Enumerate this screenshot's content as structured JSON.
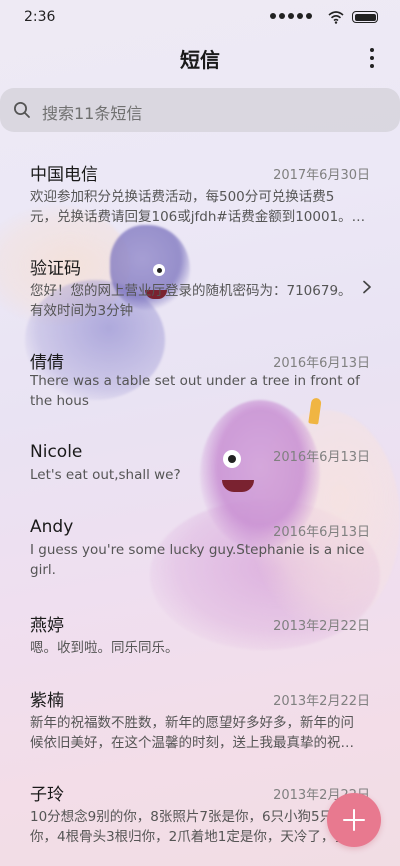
{
  "status_bar": {
    "time": "2:36",
    "icons": [
      "signal-dots-icon",
      "wifi-icon",
      "battery-icon"
    ]
  },
  "header": {
    "title": "短信",
    "more_icon": "more-vertical-icon"
  },
  "search": {
    "placeholder": "搜索11条短信",
    "icon": "search-icon"
  },
  "messages": [
    {
      "name": "中国电信",
      "date": "2017年6月30日",
      "line1": "欢迎参加积分兑换话费活动，每500分可兑换话费5",
      "line2": "元，兑换话费请回复106或jfdh#话费金额到10001。…"
    },
    {
      "name": "验证码",
      "date": "",
      "line1": "您好！您的网上营业厅登录的随机密码为：710679。",
      "line2": "有效时间为3分钟"
    },
    {
      "name": "倩倩",
      "date": "2016年6月13日",
      "line1": "There was a table set out under a tree in front of",
      "line2": "the hous"
    },
    {
      "name": "Nicole",
      "date": "2016年6月13日",
      "line1": "Let's eat out,shall we?",
      "line2": ""
    },
    {
      "name": "Andy",
      "date": "2016年6月13日",
      "line1": "I guess you're some lucky guy.Stephanie is a nice",
      "line2": "girl."
    },
    {
      "name": "燕婷",
      "date": "2013年2月22日",
      "line1": "嗯。收到啦。同乐同乐。",
      "line2": ""
    },
    {
      "name": "紫楠",
      "date": "2013年2月22日",
      "line1": "新年的祝福数不胜数，新年的愿望好多好多，新年的问",
      "line2": "候依旧美好，在这个温馨的时刻，送上我最真挚的祝…"
    },
    {
      "name": "子玲",
      "date": "2013年2月22日",
      "line1": "10分想念9别的你，8张照片7张是你，6只小狗5只是",
      "line2": "你，4根骨头3根归你，2爪着地1定是你，天冷了，我…"
    }
  ],
  "fab": {
    "icon": "plus-icon",
    "color": "#e8798f"
  }
}
